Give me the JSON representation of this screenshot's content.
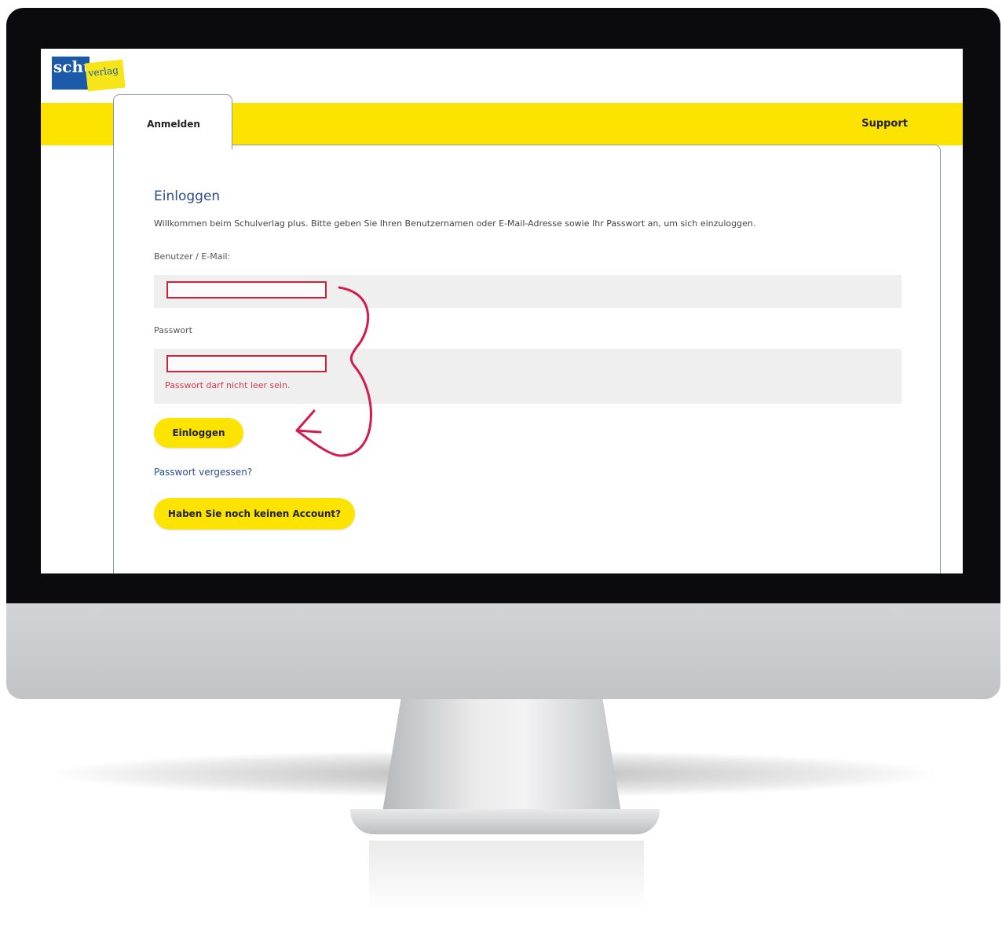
{
  "logo": {
    "part1": "schul",
    "part2": "verlag",
    "colors": {
      "blue": "#1a5aa8",
      "yellow": "#f7e51a"
    }
  },
  "nav": {
    "tab_active": "Anmelden",
    "support": "Support",
    "bar_color": "#fce400"
  },
  "login": {
    "title": "Einloggen",
    "intro": "Willkommen beim Schulverlag plus. Bitte geben Sie Ihren Benutzernamen oder E-Mail-Adresse sowie Ihr Passwort an, um sich einzuloggen.",
    "user_label": "Benutzer / E-Mail:",
    "user_value": "",
    "password_label": "Passwort",
    "password_value": "",
    "password_error": "Passwort darf nicht leer sein.",
    "submit": "Einloggen",
    "forgot": "Passwort vergessen?",
    "register": "Haben Sie noch keinen Account?",
    "error_color": "#cc2336",
    "annotation_color": "#d41b4f"
  }
}
